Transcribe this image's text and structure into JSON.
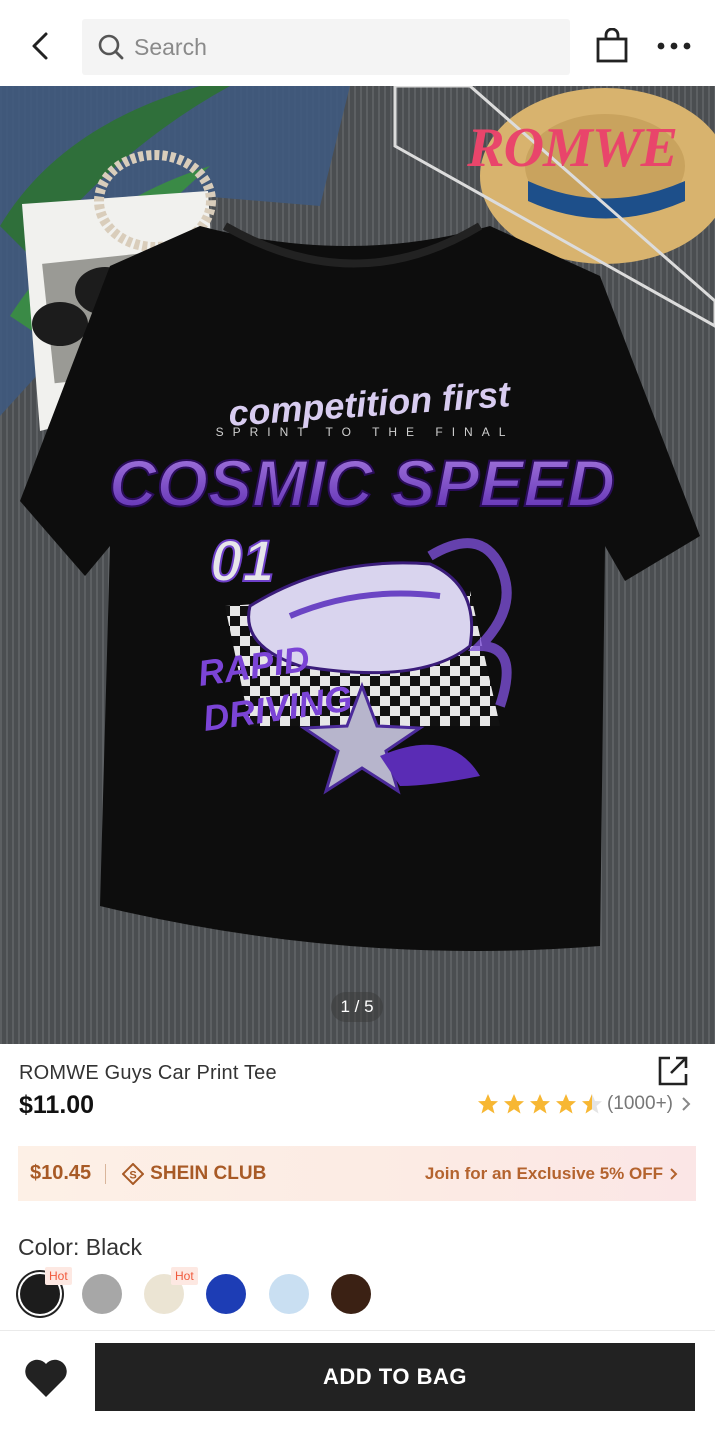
{
  "header": {
    "search_placeholder": "Search",
    "icons": [
      "back-arrow-icon",
      "search-icon",
      "shopping-bag-icon",
      "more-icon"
    ]
  },
  "gallery": {
    "brand_logo": "ROMWE",
    "counter": "1 / 5",
    "current_image": 1,
    "total_images": 5
  },
  "product": {
    "title": "ROMWE Guys Car Print Tee",
    "price": "$11.00",
    "rating": 4.5,
    "review_count": "(1000+)"
  },
  "club": {
    "price": "$10.45",
    "name": "SHEIN CLUB",
    "cta": "Join for an Exclusive 5% OFF"
  },
  "color": {
    "label": "Color: Black",
    "swatches": [
      {
        "name": "Black",
        "hex": "#1c1c1c",
        "hot": "Hot",
        "selected": true
      },
      {
        "name": "Grey",
        "hex": "#a7a7a7",
        "hot": "",
        "selected": false
      },
      {
        "name": "Beige",
        "hex": "#ebe4d3",
        "hot": "Hot",
        "selected": false
      },
      {
        "name": "Royal Blue",
        "hex": "#1d3db5",
        "hot": "",
        "selected": false
      },
      {
        "name": "Light Blue",
        "hex": "#c9dff2",
        "hot": "",
        "selected": false
      },
      {
        "name": "Coffee",
        "hex": "#3b2114",
        "hot": "",
        "selected": false
      }
    ]
  },
  "actions": {
    "add_to_bag": "ADD TO BAG"
  },
  "colors": {
    "accent_club": "#a85a26",
    "star": "#f7b733",
    "brand_pink": "#e9456b",
    "button": "#222222"
  }
}
